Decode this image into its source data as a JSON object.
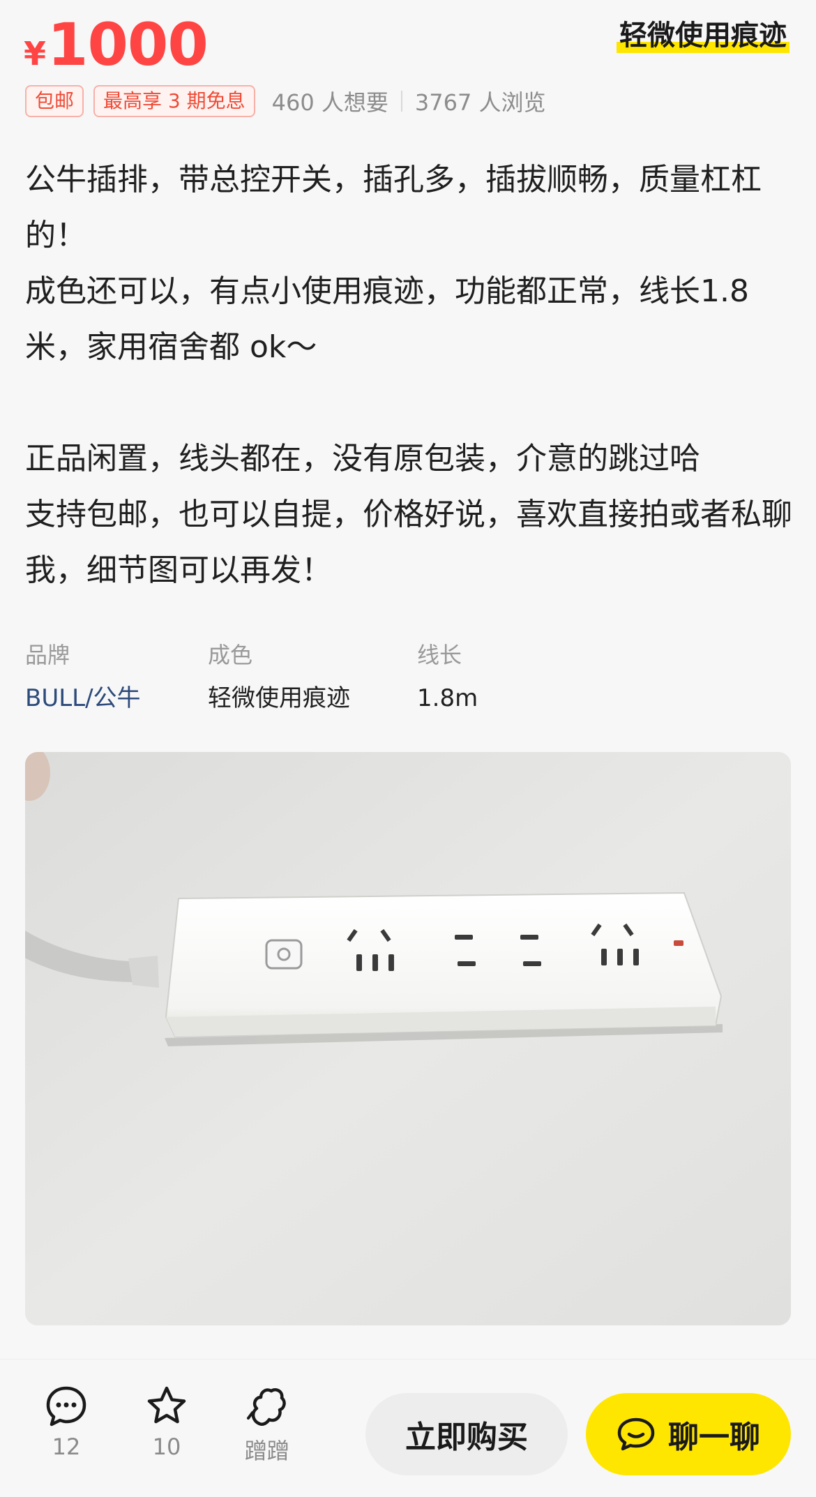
{
  "header": {
    "currency": "¥",
    "price": "1000",
    "condition_badge": "轻微使用痕迹"
  },
  "tags": [
    "包邮",
    "最高享 3 期免息"
  ],
  "stats": {
    "wants": "460 人想要",
    "views": "3767 人浏览"
  },
  "description": [
    "公牛插排，带总控开关，插孔多，插拔顺畅，质量杠杠的！",
    "成色还可以，有点小使用痕迹，功能都正常，线长1.8米，家用宿舍都 ok～",
    "",
    "正品闲置，线头都在，没有原包装，介意的跳过哈",
    "支持包邮，也可以自提，价格好说，喜欢直接拍或者私聊我，细节图可以再发！"
  ],
  "specs": [
    {
      "key": "品牌",
      "value": "BULL/公牛"
    },
    {
      "key": "成色",
      "value": "轻微使用痕迹"
    },
    {
      "key": "线长",
      "value": "1.8m"
    }
  ],
  "photo": {
    "icon": "power-strip-photo"
  },
  "bottom_bar": {
    "comments": {
      "icon": "comment-icon",
      "count": "12"
    },
    "favorites": {
      "icon": "star-icon",
      "count": "10"
    },
    "nudge": {
      "icon": "nudge-icon",
      "label": "蹭蹭"
    },
    "buy_label": "立即购买",
    "chat_label": "聊一聊"
  },
  "colors": {
    "price": "#ff4444",
    "accent_yellow": "#ffe600",
    "tag_text": "#ee4b36",
    "brand_link": "#2c4a7a"
  }
}
